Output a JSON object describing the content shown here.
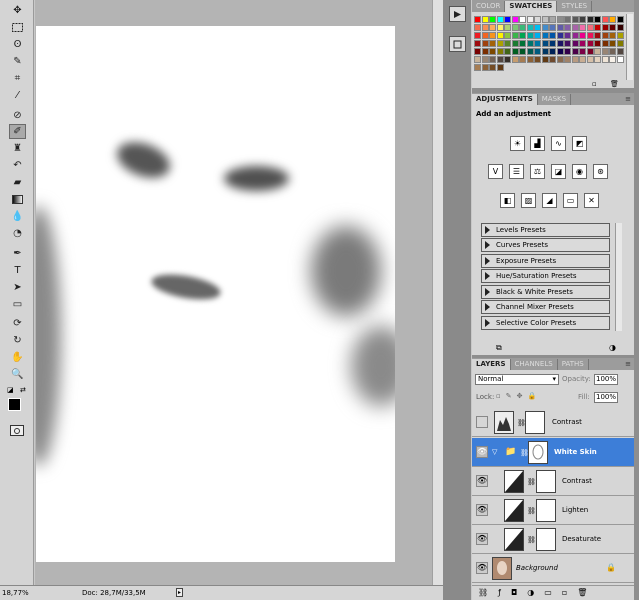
{
  "toolbar": {
    "tools": [
      "move",
      "marquee",
      "lasso",
      "quick-select",
      "crop",
      "eyedropper",
      "healing",
      "brush",
      "stamp",
      "history-brush",
      "eraser",
      "gradient",
      "blur",
      "dodge",
      "pen",
      "type",
      "path-select",
      "shape",
      "3d-rotate",
      "3d-orbit",
      "hand",
      "zoom"
    ],
    "selected": "brush"
  },
  "status": {
    "zoom": "18,77%",
    "doc": "Doc: 28,7M/33,5M"
  },
  "swatches_panel": {
    "tabs": [
      "COLOR",
      "SWATCHES",
      "STYLES"
    ],
    "active": "SWATCHES"
  },
  "adjustments_panel": {
    "tabs": [
      "ADJUSTMENTS",
      "MASKS"
    ],
    "active": "ADJUSTMENTS",
    "heading": "Add an adjustment",
    "presets": [
      "Levels Presets",
      "Curves Presets",
      "Exposure Presets",
      "Hue/Saturation Presets",
      "Black & White Presets",
      "Channel Mixer Presets",
      "Selective Color Presets"
    ]
  },
  "layers_panel": {
    "tabs": [
      "LAYERS",
      "CHANNELS",
      "PATHS"
    ],
    "active": "LAYERS",
    "blend_mode": "Normal",
    "opacity_label": "Opacity:",
    "opacity_value": "100%",
    "lock_label": "Lock:",
    "fill_label": "Fill:",
    "fill_value": "100%",
    "layers": [
      {
        "name": "Contrast",
        "visible": false,
        "italic": false
      },
      {
        "name": "White Skin",
        "visible": true,
        "group": true,
        "selected": true
      },
      {
        "name": "Contrast",
        "visible": true,
        "indent": true
      },
      {
        "name": "Lighten",
        "visible": true,
        "indent": true
      },
      {
        "name": "Desaturate",
        "visible": true,
        "indent": true
      },
      {
        "name": "Background",
        "visible": true,
        "italic": true
      }
    ]
  },
  "colors": {
    "accent": "#3d7ed8",
    "panel": "#d6d6d6"
  }
}
